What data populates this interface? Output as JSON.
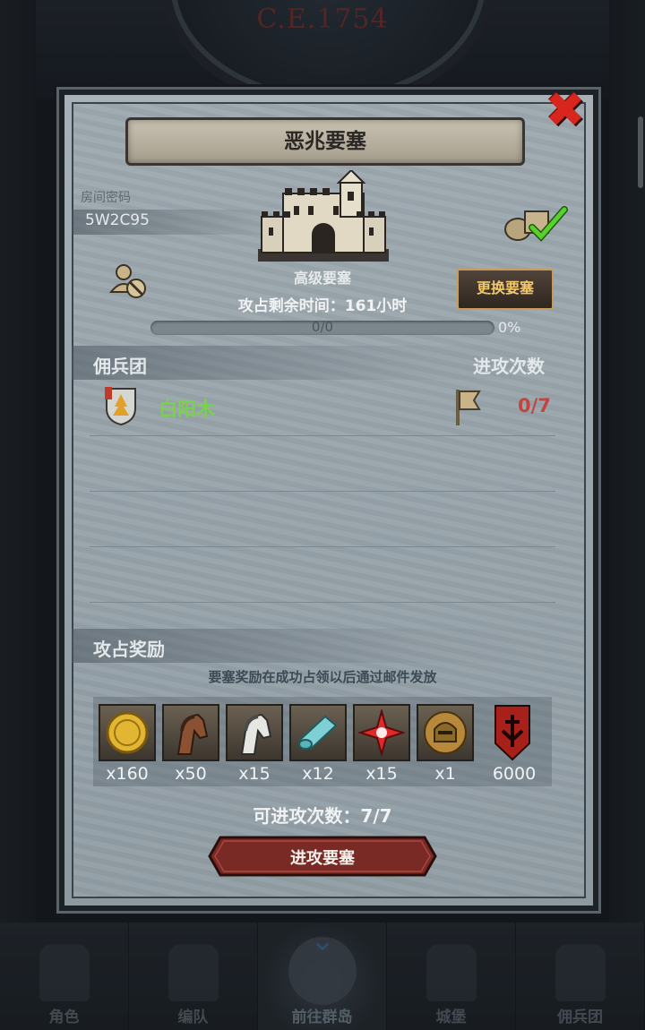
{
  "background": {
    "year": "C.E.1754",
    "bottom_nav": [
      {
        "label": "角色",
        "icon": "character-icon"
      },
      {
        "label": "编队",
        "icon": "formation-icon"
      },
      {
        "label": "前往群岛",
        "icon": "islands-icon",
        "active": true
      },
      {
        "label": "城堡",
        "icon": "castle-icon"
      },
      {
        "label": "佣兵团",
        "icon": "mercenary-icon"
      }
    ]
  },
  "dialog": {
    "title": "恶兆要塞",
    "room_label": "房间密码",
    "room_code": "5W2C95",
    "fortress_level": "高级要塞",
    "change_button": "更换要塞",
    "time_text": "攻占剩余时间：161小时",
    "progress": {
      "text": "0/0",
      "percent_text": "0%",
      "value": 0
    },
    "section_mercenary": "佣兵团",
    "section_attacks": "进攻次数",
    "guild": {
      "name": "白阳木",
      "attacks": "0/7"
    },
    "section_rewards": "攻占奖励",
    "reward_note": "要塞奖励在成功占领以后通过邮件发放",
    "rewards": [
      {
        "icon": "gold-coin-icon",
        "qty": "x160"
      },
      {
        "icon": "brown-horse-icon",
        "qty": "x50"
      },
      {
        "icon": "white-horse-icon",
        "qty": "x15"
      },
      {
        "icon": "cloth-roll-icon",
        "qty": "x12"
      },
      {
        "icon": "red-star-icon",
        "qty": "x15"
      },
      {
        "icon": "knight-helmet-icon",
        "qty": "x1"
      },
      {
        "icon": "guild-banner-icon",
        "qty": "6000"
      }
    ],
    "attempts_text": "可进攻次数：7/7",
    "attack_button": "进攻要塞"
  },
  "colors": {
    "accent_red": "#d8261f",
    "guild_green": "#7ad24a",
    "count_red": "#c0463f",
    "button_gold": "#f2c86a"
  }
}
